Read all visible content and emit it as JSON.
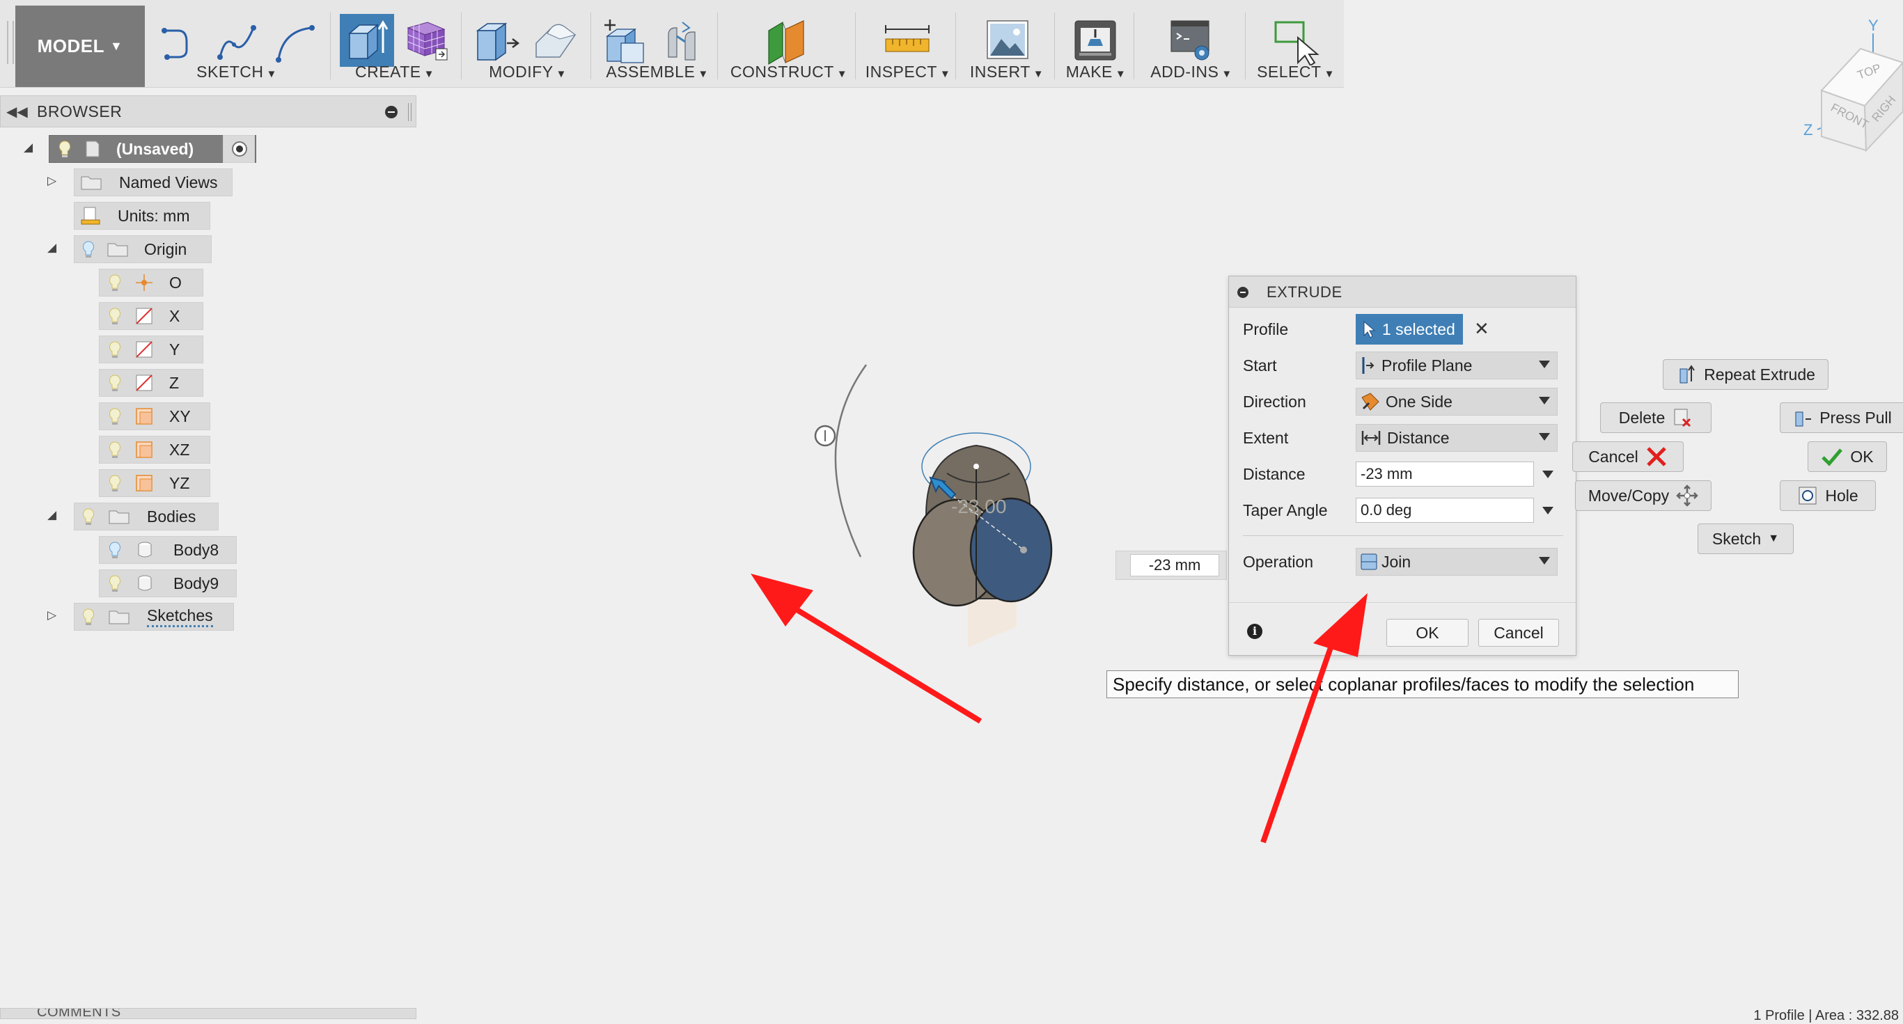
{
  "toolbar": {
    "workspace": "MODEL",
    "groups": {
      "sketch": "SKETCH",
      "create": "CREATE",
      "modify": "MODIFY",
      "assemble": "ASSEMBLE",
      "construct": "CONSTRUCT",
      "inspect": "INSPECT",
      "insert": "INSERT",
      "make": "MAKE",
      "addins": "ADD-INS",
      "select": "SELECT"
    }
  },
  "browser": {
    "title": "BROWSER",
    "root": "(Unsaved)",
    "named_views": "Named Views",
    "units": "Units: mm",
    "origin": "Origin",
    "origin_items": [
      "O",
      "X",
      "Y",
      "Z",
      "XY",
      "XZ",
      "YZ"
    ],
    "bodies": "Bodies",
    "body_items": [
      "Body8",
      "Body9"
    ],
    "sketches": "Sketches"
  },
  "viewcube": {
    "top": "TOP",
    "front": "FRONT",
    "right": "RIGH",
    "axis_y": "Y",
    "axis_z": "Z"
  },
  "canvas": {
    "dimension_label": "-23.00",
    "distance_field": "-23 mm"
  },
  "extrude": {
    "title": "EXTRUDE",
    "profile_label": "Profile",
    "profile_value": "1 selected",
    "start_label": "Start",
    "start_value": "Profile Plane",
    "direction_label": "Direction",
    "direction_value": "One Side",
    "extent_label": "Extent",
    "extent_value": "Distance",
    "distance_label": "Distance",
    "distance_value": "-23 mm",
    "taper_label": "Taper Angle",
    "taper_value": "0.0 deg",
    "operation_label": "Operation",
    "operation_value": "Join",
    "ok": "OK",
    "cancel": "Cancel"
  },
  "marking_menu": {
    "repeat": "Repeat Extrude",
    "delete": "Delete",
    "press_pull": "Press Pull",
    "cancel": "Cancel",
    "ok": "OK",
    "move_copy": "Move/Copy",
    "hole": "Hole",
    "sketch": "Sketch"
  },
  "tooltip": "Specify distance, or select coplanar profiles/faces to modify the selection",
  "comments": "COMMENTS",
  "status": "1 Profile | Area : 332.88",
  "colors": {
    "accent": "#3f7fb5",
    "arrow": "#ff1a1a",
    "toolbar": "#e6e6e6"
  }
}
